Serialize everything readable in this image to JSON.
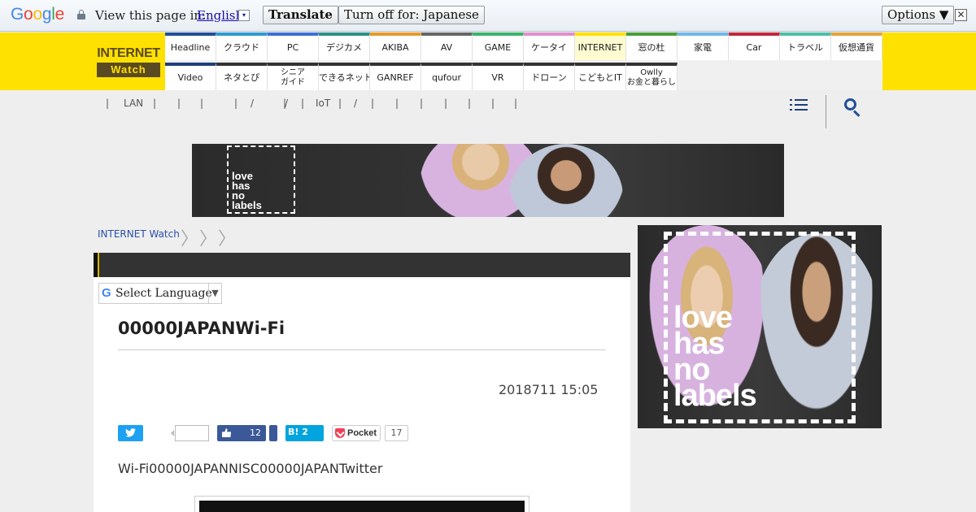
{
  "translate_bar": {
    "logo": "Google",
    "view_label": "View this page in:",
    "language": "English",
    "language_arrow": "▾",
    "translate_button": "Translate",
    "turn_off_button": "Turn off for: Japanese",
    "options_button": "Options ▼",
    "close": "✕"
  },
  "site": {
    "logo_line1": "INTERNET",
    "logo_line2": "Watch"
  },
  "nav": {
    "row1": [
      {
        "label": "Headline",
        "color": "#1f4f9a"
      },
      {
        "label": "クラウド",
        "color": "#2d9bd2"
      },
      {
        "label": "PC",
        "color": "#3d6fd6"
      },
      {
        "label": "デジカメ",
        "color": "#2a8f8a"
      },
      {
        "label": "AKIBA",
        "color": "#e79a2a"
      },
      {
        "label": "AV",
        "color": "#666666"
      },
      {
        "label": "GAME",
        "color": "#3ab36b"
      },
      {
        "label": "ケータイ",
        "color": "#e08fcf"
      },
      {
        "label": "INTERNET",
        "color": "#ffe100"
      },
      {
        "label": "窓の杜",
        "color": "#4a9e3a"
      },
      {
        "label": "家電",
        "color": "#6fb7e8"
      },
      {
        "label": "Car",
        "color": "#c0283c"
      },
      {
        "label": "トラベル",
        "color": "#4dbfa8"
      },
      {
        "label": "仮想通貨",
        "color": "#e3a23a"
      }
    ],
    "row2": [
      {
        "label": "Video",
        "color": "#1f3f7a"
      },
      {
        "label": "ネタとぴ",
        "color": "#333333"
      },
      {
        "label": "シニア\nガイド",
        "color": "#333333"
      },
      {
        "label": "できるネット",
        "color": "#333333"
      },
      {
        "label": "GANREF",
        "color": "#333333"
      },
      {
        "label": "qufour",
        "color": "#333333"
      },
      {
        "label": "VR",
        "color": "#333333"
      },
      {
        "label": "ドローン",
        "color": "#333333"
      },
      {
        "label": "こどもとIT",
        "color": "#333333"
      },
      {
        "label": "Owlly\nお金と暮らし",
        "color": "#333333"
      }
    ],
    "active": "INTERNET"
  },
  "subnav": {
    "items": [
      "|",
      "LAN",
      "|",
      "|",
      "|",
      "|",
      "/",
      "|",
      "/",
      "|",
      "IoT",
      "|",
      "/",
      "|",
      "|",
      "|",
      "|",
      "|",
      "|",
      "|"
    ]
  },
  "ad_banner": {
    "text": "love\nhas\nno\nlabels"
  },
  "breadcrumb": {
    "home": "INTERNET Watch",
    "separator": "〉"
  },
  "article": {
    "select_language": "Select Language",
    "select_caret": "▼",
    "title": "00000JAPANWi-Fi",
    "date": "2018711 15:05",
    "lead": "Wi-Fi00000JAPANNISC00000JAPANTwitter",
    "share": {
      "facebook_count": "12",
      "hatena_label": "B! 2",
      "pocket_label": "Pocket",
      "pocket_count": "17"
    }
  },
  "side_ad": {
    "text": "love\nhas\nno\nlabels"
  }
}
